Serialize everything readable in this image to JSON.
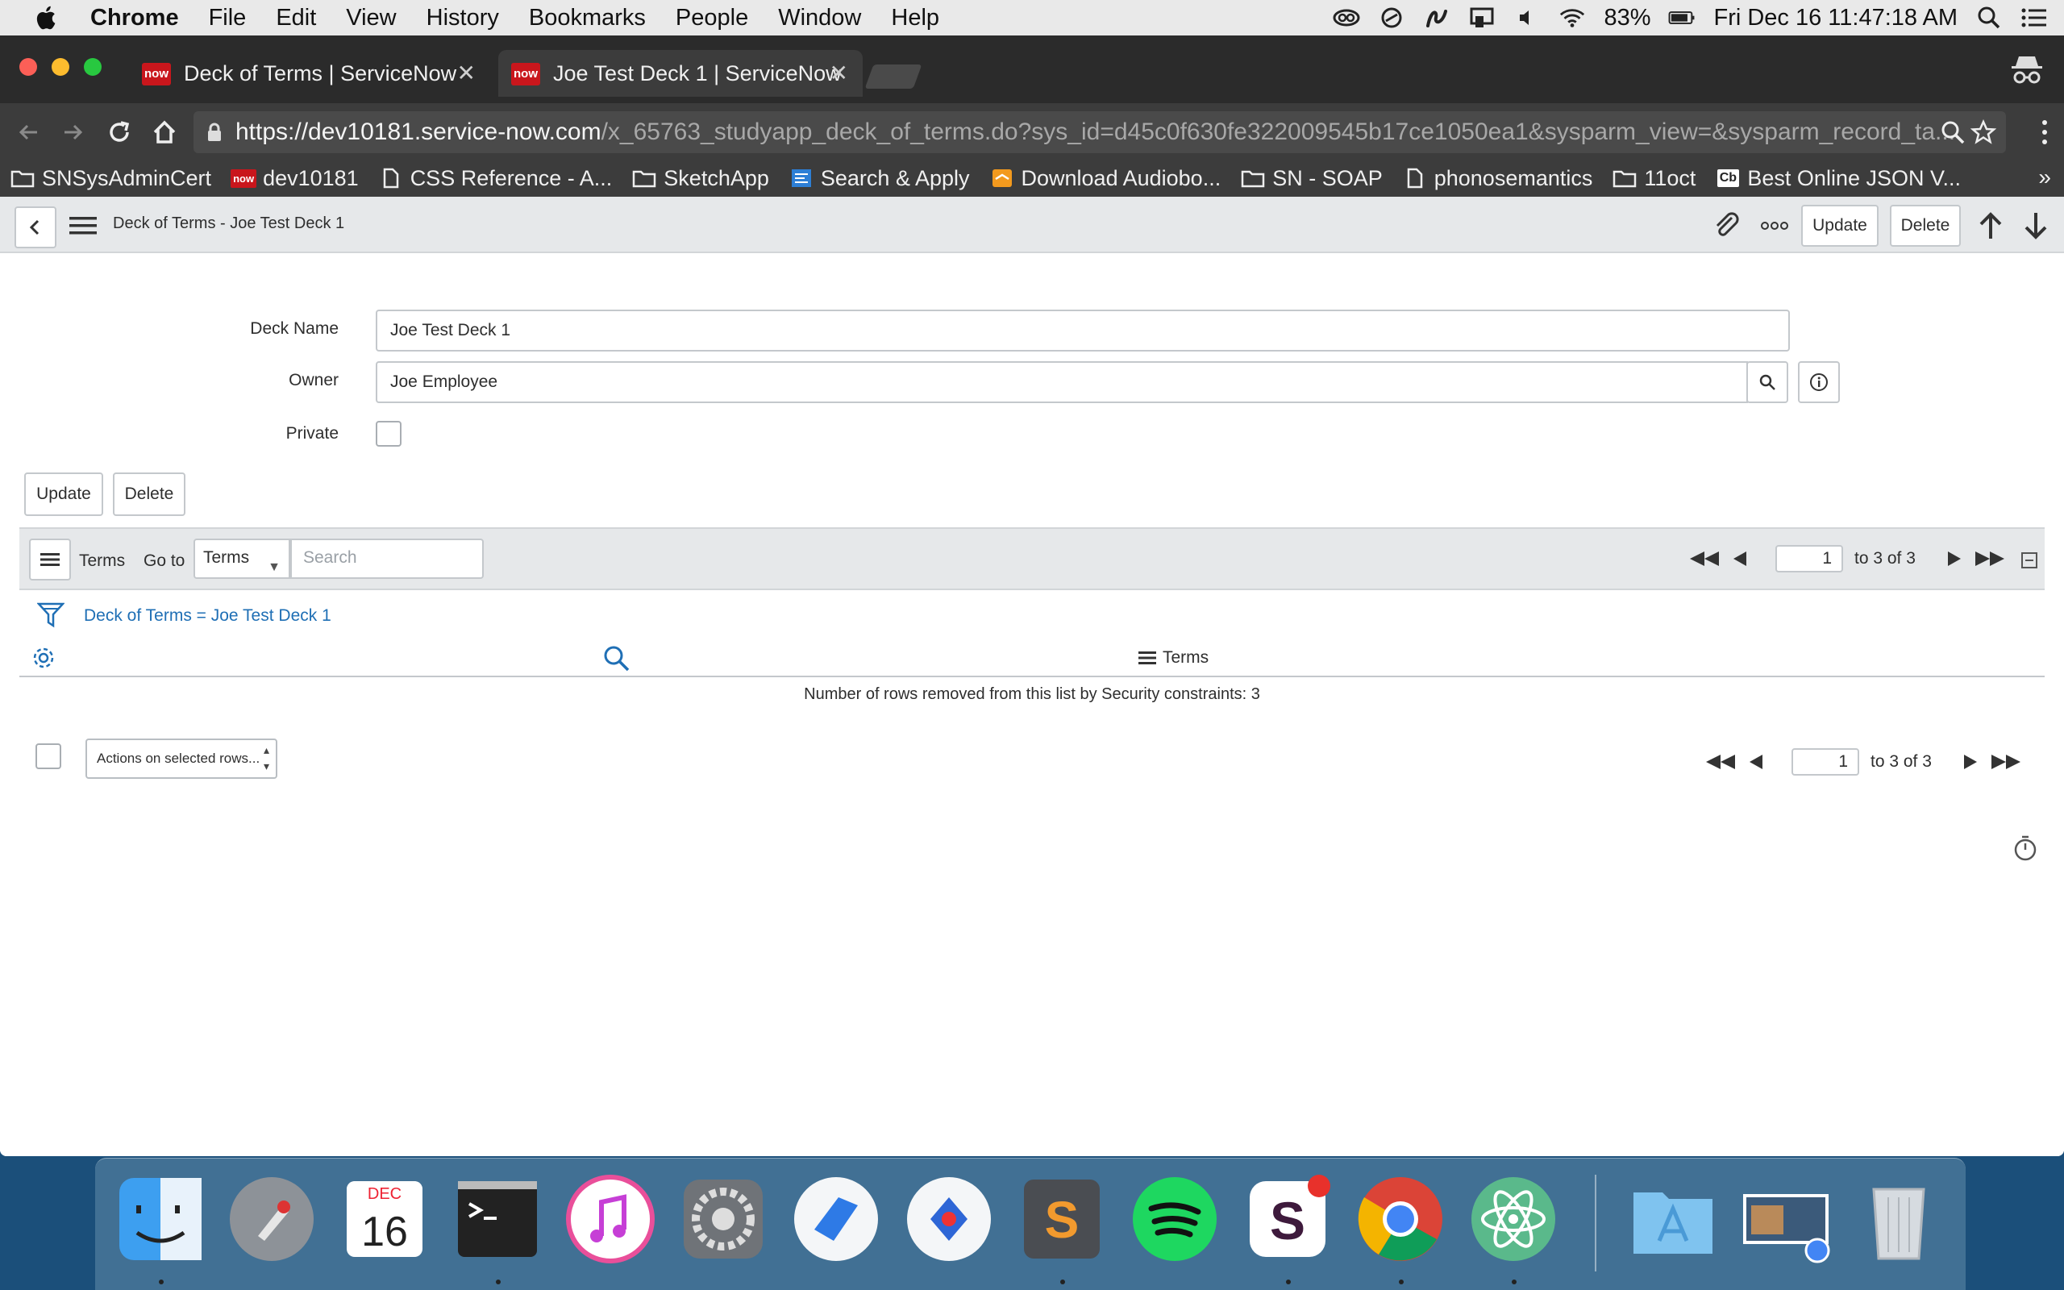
{
  "menubar": {
    "app": "Chrome",
    "items": [
      "File",
      "Edit",
      "View",
      "History",
      "Bookmarks",
      "People",
      "Window",
      "Help"
    ],
    "battery": "83%",
    "clock": "Fri Dec 16  11:47:18 AM"
  },
  "browser": {
    "tabs": [
      {
        "favicon": "now",
        "title": "Deck of Terms | ServiceNow"
      },
      {
        "favicon": "now",
        "title": "Joe Test Deck 1 | ServiceNow"
      }
    ],
    "url_host": "https://dev10181.service-now.com",
    "url_path": "/x_65763_studyapp_deck_of_terms.do?sys_id=d45c0f630fe322009545b17ce1050ea1&sysparm_view=&sysparm_record_ta...",
    "bookmarks": [
      {
        "icon": "folder-icon",
        "label": "SNSysAdminCert"
      },
      {
        "icon": "servicenow-icon",
        "label": "dev10181",
        "badge": "now"
      },
      {
        "icon": "page-icon",
        "label": "CSS Reference - A..."
      },
      {
        "icon": "folder-icon",
        "label": "SketchApp"
      },
      {
        "icon": "app-icon",
        "label": "Search & Apply"
      },
      {
        "icon": "audible-icon",
        "label": "Download Audiobo..."
      },
      {
        "icon": "folder-icon",
        "label": "SN - SOAP"
      },
      {
        "icon": "page-icon",
        "label": "phonosemantics"
      },
      {
        "icon": "folder-icon",
        "label": "11oct"
      },
      {
        "icon": "cb-icon",
        "label": "Best Online JSON V...",
        "badge": "Cb"
      }
    ],
    "bookmarks_more": "»"
  },
  "form": {
    "title": "Deck of Terms - Joe Test Deck 1",
    "header_update": "Update",
    "header_delete": "Delete",
    "deck_name_label": "Deck Name",
    "deck_name_value": "Joe Test Deck 1",
    "owner_label": "Owner",
    "owner_value": "Joe Employee",
    "private_label": "Private",
    "update_label": "Update",
    "delete_label": "Delete"
  },
  "related_list": {
    "title": "Terms",
    "goto_label": "Go to",
    "select_value": "Terms",
    "search_placeholder": "Search",
    "page_value": "1",
    "range": "to 3 of 3",
    "filter_text": "Deck of Terms = Joe Test Deck 1",
    "column": "Terms",
    "security_message": "Number of rows removed from this list by Security constraints: 3",
    "actions_label": "Actions on selected rows...",
    "bottom_page_value": "1",
    "bottom_range": "to 3 of 3"
  },
  "calendar": {
    "month": "DEC",
    "day": "16"
  },
  "colors": {
    "header_bg": "#e6e8ea",
    "link": "#1f6fb5",
    "servicenow_red": "#c9161c",
    "chrome_dark": "#3c3c3c"
  }
}
